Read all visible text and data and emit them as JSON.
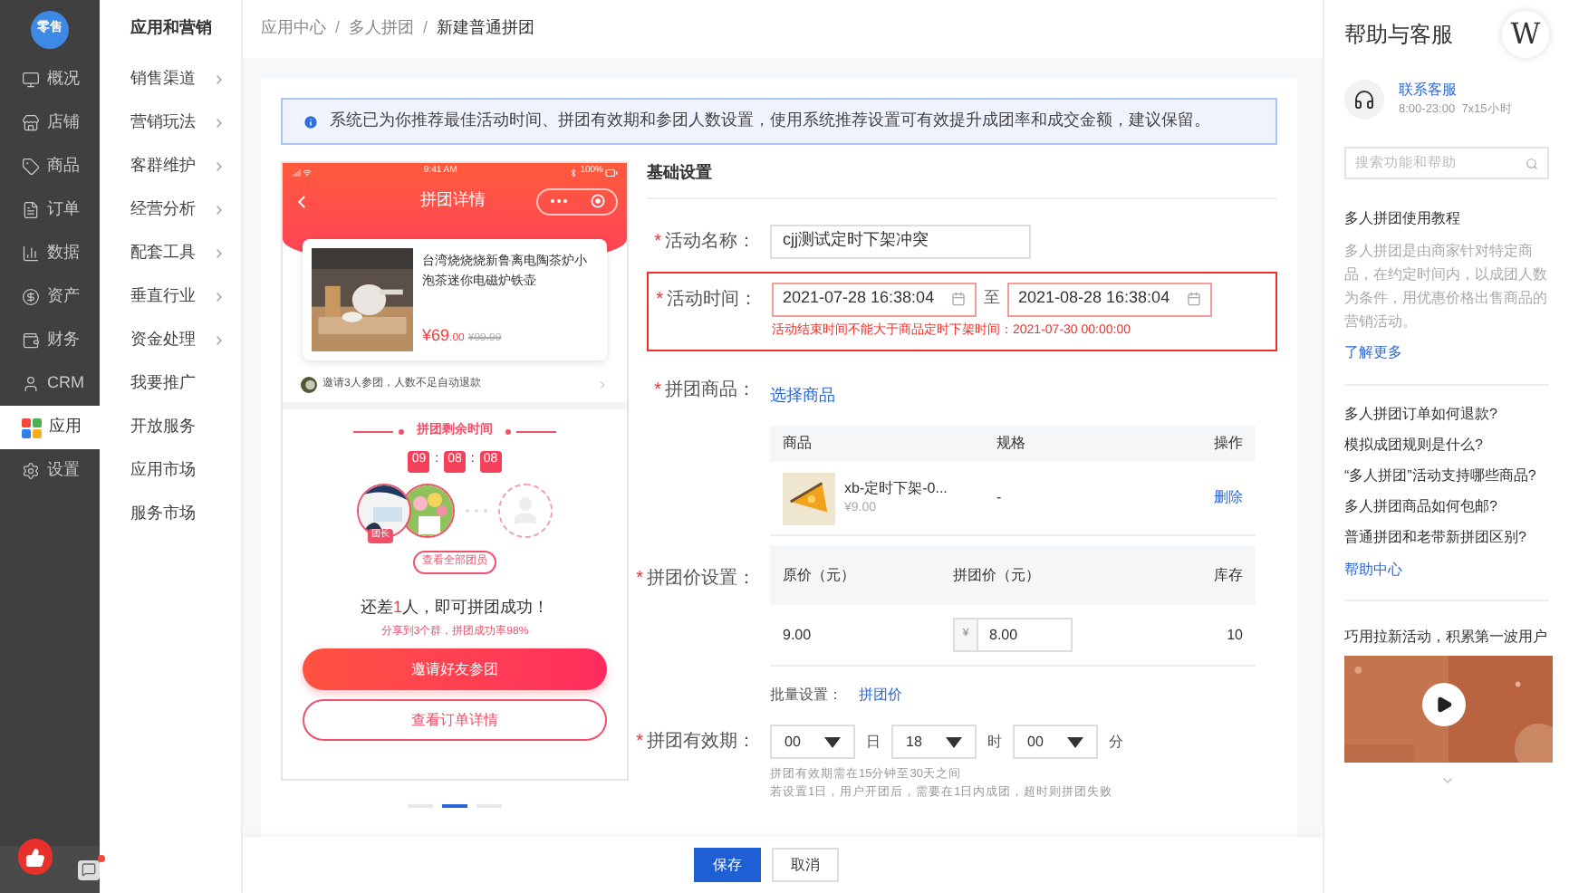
{
  "brand": {
    "logo": "零售"
  },
  "sidebar": {
    "items": [
      {
        "label": "概况",
        "selected": false
      },
      {
        "label": "店铺",
        "selected": false
      },
      {
        "label": "商品",
        "selected": false
      },
      {
        "label": "订单",
        "selected": false
      },
      {
        "label": "数据",
        "selected": false
      },
      {
        "label": "资产",
        "selected": false
      },
      {
        "label": "财务",
        "selected": false
      },
      {
        "label": "CRM",
        "selected": false
      },
      {
        "label": "应用",
        "selected": true
      },
      {
        "label": "设置",
        "selected": false
      }
    ]
  },
  "subnav": {
    "title": "应用和营销",
    "items": [
      {
        "label": "销售渠道",
        "expandable": true
      },
      {
        "label": "营销玩法",
        "expandable": true
      },
      {
        "label": "客群维护",
        "expandable": true
      },
      {
        "label": "经营分析",
        "expandable": true
      },
      {
        "label": "配套工具",
        "expandable": true
      },
      {
        "label": "垂直行业",
        "expandable": true
      },
      {
        "label": "资金处理",
        "expandable": true
      },
      {
        "label": "我要推广",
        "expandable": false
      },
      {
        "label": "开放服务",
        "expandable": false
      },
      {
        "label": "应用市场",
        "expandable": false
      },
      {
        "label": "服务市场",
        "expandable": false
      }
    ]
  },
  "breadcrumb": [
    {
      "kind": "link",
      "text": "应用中心"
    },
    {
      "kind": "separator",
      "text": "/"
    },
    {
      "kind": "link",
      "text": "多人拼团"
    },
    {
      "kind": "separator",
      "text": "/"
    },
    {
      "kind": "current",
      "text": "新建普通拼团"
    }
  ],
  "alert": {
    "text": "系统已为你推荐最佳活动时间、拼团有效期和参团人数设置，使用系统推荐设置可有效提升成团率和成交金额，建议保留。"
  },
  "preview": {
    "status_time": "9:41 AM",
    "battery": "100%",
    "title": "拼团详情",
    "product": {
      "name": "台湾烧烧烧新鲁离电陶茶炉小泡茶迷你电磁炉铁壶",
      "price": "¥69",
      "cents": ".00",
      "original_price": "¥99.99"
    },
    "invite_note": "邀请3人参团，人数不足自动退款",
    "timer_title": "拼团剩余时间",
    "countdown": [
      {
        "kind": "digits",
        "text": "09"
      },
      {
        "kind": "colon",
        "text": ":"
      },
      {
        "kind": "digits",
        "text": "08"
      },
      {
        "kind": "colon",
        "text": ":"
      },
      {
        "kind": "digits",
        "text": "08"
      }
    ],
    "leader_badge": "团长",
    "members_button": "查看全部团员",
    "status": {
      "before": "还差",
      "highlight": "1",
      "after": "人，即可拼团成功！"
    },
    "hint": "分享到3个群，拼团成功率98%",
    "buttons": [
      {
        "kind": "primary",
        "label": "邀请好友参团"
      },
      {
        "kind": "outline",
        "label": "查看订单详情"
      }
    ],
    "pages": [
      {
        "selected": false
      },
      {
        "selected": true
      },
      {
        "selected": false
      }
    ]
  },
  "form": {
    "section": "基础设置",
    "name": {
      "marker": "*",
      "label": "活动名称：",
      "value": "cjj测试定时下架冲突"
    },
    "time": {
      "marker": "*",
      "label": "活动时间：",
      "invalid": true,
      "start": "2021-07-28 16:38:04",
      "to": "至",
      "end": "2021-08-28 16:38:04",
      "error": "活动结束时间不能大于商品定时下架时间：2021-07-30 00:00:00"
    },
    "goods": {
      "marker": "*",
      "label": "拼团商品：",
      "link": "选择商品",
      "columns": [
        "商品",
        "规格",
        "操作"
      ],
      "row": {
        "name": "xb-定时下架-0...",
        "price": "¥9.00",
        "spec": "-",
        "action": "删除"
      }
    },
    "price": {
      "marker": "*",
      "label": "拼团价设置：",
      "columns": [
        "原价（元）",
        "拼团价（元）",
        "库存"
      ],
      "row": {
        "original": "9.00",
        "prefix": "¥",
        "value": "8.00",
        "stock": "10"
      },
      "batch_label": "批量设置：",
      "batch_link": "拼团价"
    },
    "validity": {
      "marker": "*",
      "label": "拼团有效期：",
      "parts": [
        {
          "value": "00",
          "unit": "日"
        },
        {
          "value": "18",
          "unit": "时"
        },
        {
          "value": "00",
          "unit": "分"
        }
      ],
      "hints": [
        "拼团有效期需在15分钟至30天之间",
        "若设置1日，用户开团后，需要在1日内成团，超时则拼团失败"
      ]
    }
  },
  "footer": [
    {
      "kind": "primary",
      "label": "保存"
    },
    {
      "kind": "default",
      "label": "取消"
    }
  ],
  "help": {
    "title": "帮助与客服",
    "avatar": "W",
    "contact": {
      "link": "联系客服",
      "hours": "8:00-23:00  7x15小时"
    },
    "search": {
      "placeholder": "搜索功能和帮助"
    },
    "tutorial": {
      "title": "多人拼团使用教程",
      "text": "多人拼团是由商家针对特定商品，在约定时间内，以成团人数为条件，用优惠价格出售商品的营销活动。",
      "link": "了解更多"
    },
    "faq": [
      "多人拼团订单如何退款?",
      "模拟成团规则是什么?",
      "“多人拼团”活动支持哪些商品?",
      "多人拼团商品如何包邮?",
      "普通拼团和老带新拼团区别?"
    ],
    "center_link": "帮助中心",
    "promo": {
      "title": "巧用拉新活动，积累第一波用户"
    }
  }
}
